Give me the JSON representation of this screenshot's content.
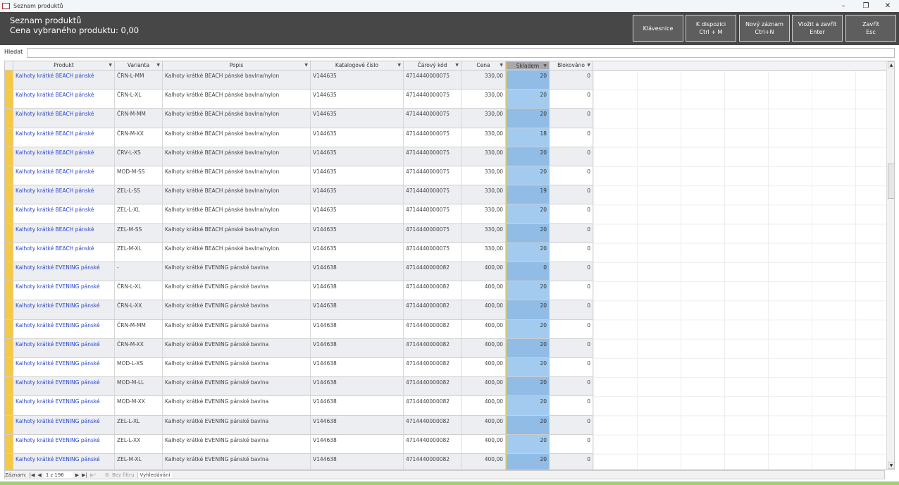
{
  "window": {
    "title": "Seznam produktů"
  },
  "header": {
    "title": "Seznam produktů",
    "price_label": "Cena vybraného produktu: 0,00",
    "buttons": [
      {
        "l1": "Klávesnice",
        "l2": ""
      },
      {
        "l1": "K dispozici",
        "l2": "Ctrl + M"
      },
      {
        "l1": "Nový záznam",
        "l2": "Ctrl+N"
      },
      {
        "l1": "Vložit a zavřít",
        "l2": "Enter"
      },
      {
        "l1": "Zavřít",
        "l2": "Esc"
      }
    ]
  },
  "search": {
    "label": "Hledat",
    "value": ""
  },
  "columns": [
    "Produkt",
    "Varianta",
    "Popis",
    "Katalogové číslo",
    "Čárový kód",
    "Cena",
    "Skladem",
    "Blokováno"
  ],
  "rows": [
    [
      "Kalhoty krátké BEACH pánské",
      "ČRN-L-MM",
      "Kalhoty krátké BEACH pánské bavlna/nylon",
      "V144635",
      "4714440000075",
      "330,00",
      "20",
      "0"
    ],
    [
      "Kalhoty krátké BEACH pánské",
      "ČRN-L-XL",
      "Kalhoty krátké BEACH pánské bavlna/nylon",
      "V144635",
      "4714440000075",
      "330,00",
      "20",
      "0"
    ],
    [
      "Kalhoty krátké BEACH pánské",
      "ČRN-M-MM",
      "Kalhoty krátké BEACH pánské bavlna/nylon",
      "V144635",
      "4714440000075",
      "330,00",
      "20",
      "0"
    ],
    [
      "Kalhoty krátké BEACH pánské",
      "ČRN-M-XX",
      "Kalhoty krátké BEACH pánské bavlna/nylon",
      "V144635",
      "4714440000075",
      "330,00",
      "18",
      "0"
    ],
    [
      "Kalhoty krátké BEACH pánské",
      "ČRV-L-XS",
      "Kalhoty krátké BEACH pánské bavlna/nylon",
      "V144635",
      "4714440000075",
      "330,00",
      "20",
      "0"
    ],
    [
      "Kalhoty krátké BEACH pánské",
      "MOD-M-SS",
      "Kalhoty krátké BEACH pánské bavlna/nylon",
      "V144635",
      "4714440000075",
      "330,00",
      "20",
      "0"
    ],
    [
      "Kalhoty krátké BEACH pánské",
      "ZEL-L-SS",
      "Kalhoty krátké BEACH pánské bavlna/nylon",
      "V144635",
      "4714440000075",
      "330,00",
      "19",
      "0"
    ],
    [
      "Kalhoty krátké BEACH pánské",
      "ZEL-L-XL",
      "Kalhoty krátké BEACH pánské bavlna/nylon",
      "V144635",
      "4714440000075",
      "330,00",
      "20",
      "0"
    ],
    [
      "Kalhoty krátké BEACH pánské",
      "ZEL-M-SS",
      "Kalhoty krátké BEACH pánské bavlna/nylon",
      "V144635",
      "4714440000075",
      "330,00",
      "20",
      "0"
    ],
    [
      "Kalhoty krátké BEACH pánské",
      "ZEL-M-XL",
      "Kalhoty krátké BEACH pánské bavlna/nylon",
      "V144635",
      "4714440000075",
      "330,00",
      "20",
      "0"
    ],
    [
      "Kalhoty krátké EVENING pánské",
      "-",
      "Kalhoty krátké EVENING pánské bavlna",
      "V144638",
      "4714440000082",
      "400,00",
      "0",
      "0"
    ],
    [
      "Kalhoty krátké EVENING pánské",
      "ČRN-L-XL",
      "Kalhoty krátké EVENING pánské bavlna",
      "V144638",
      "4714440000082",
      "400,00",
      "20",
      "0"
    ],
    [
      "Kalhoty krátké EVENING pánské",
      "ČRN-L-XX",
      "Kalhoty krátké EVENING pánské bavlna",
      "V144638",
      "4714440000082",
      "400,00",
      "20",
      "0"
    ],
    [
      "Kalhoty krátké EVENING pánské",
      "ČRN-M-MM",
      "Kalhoty krátké EVENING pánské bavlna",
      "V144638",
      "4714440000082",
      "400,00",
      "20",
      "0"
    ],
    [
      "Kalhoty krátké EVENING pánské",
      "ČRN-M-XX",
      "Kalhoty krátké EVENING pánské bavlna",
      "V144638",
      "4714440000082",
      "400,00",
      "20",
      "0"
    ],
    [
      "Kalhoty krátké EVENING pánské",
      "MOD-L-XS",
      "Kalhoty krátké EVENING pánské bavlna",
      "V144638",
      "4714440000082",
      "400,00",
      "20",
      "0"
    ],
    [
      "Kalhoty krátké EVENING pánské",
      "MOD-M-LL",
      "Kalhoty krátké EVENING pánské bavlna",
      "V144638",
      "4714440000082",
      "400,00",
      "20",
      "0"
    ],
    [
      "Kalhoty krátké EVENING pánské",
      "MOD-M-XX",
      "Kalhoty krátké EVENING pánské bavlna",
      "V144638",
      "4714440000082",
      "400,00",
      "20",
      "0"
    ],
    [
      "Kalhoty krátké EVENING pánské",
      "ZEL-L-XL",
      "Kalhoty krátké EVENING pánské bavlna",
      "V144638",
      "4714440000082",
      "400,00",
      "20",
      "0"
    ],
    [
      "Kalhoty krátké EVENING pánské",
      "ZEL-L-XX",
      "Kalhoty krátké EVENING pánské bavlna",
      "V144638",
      "4714440000082",
      "400,00",
      "20",
      "0"
    ],
    [
      "Kalhoty krátké EVENING pánské",
      "ZEL-M-XL",
      "Kalhoty krátké EVENING pánské bavlna",
      "V144638",
      "4714440000082",
      "400,00",
      "20",
      "0"
    ]
  ],
  "nav": {
    "label": "Záznam:",
    "record": "1 z 196",
    "filter": "Bez filtru",
    "search": "Vyhledávání"
  },
  "icons": {
    "first": "first-record-icon",
    "prev": "prev-record-icon",
    "next": "next-record-icon",
    "last": "last-record-icon",
    "new": "new-record-icon",
    "filter": "filter-icon"
  },
  "colors": {
    "header_bg": "#474747",
    "selector": "#f6c945",
    "selected_column": "#a3cbef",
    "link": "#2b47c9"
  }
}
